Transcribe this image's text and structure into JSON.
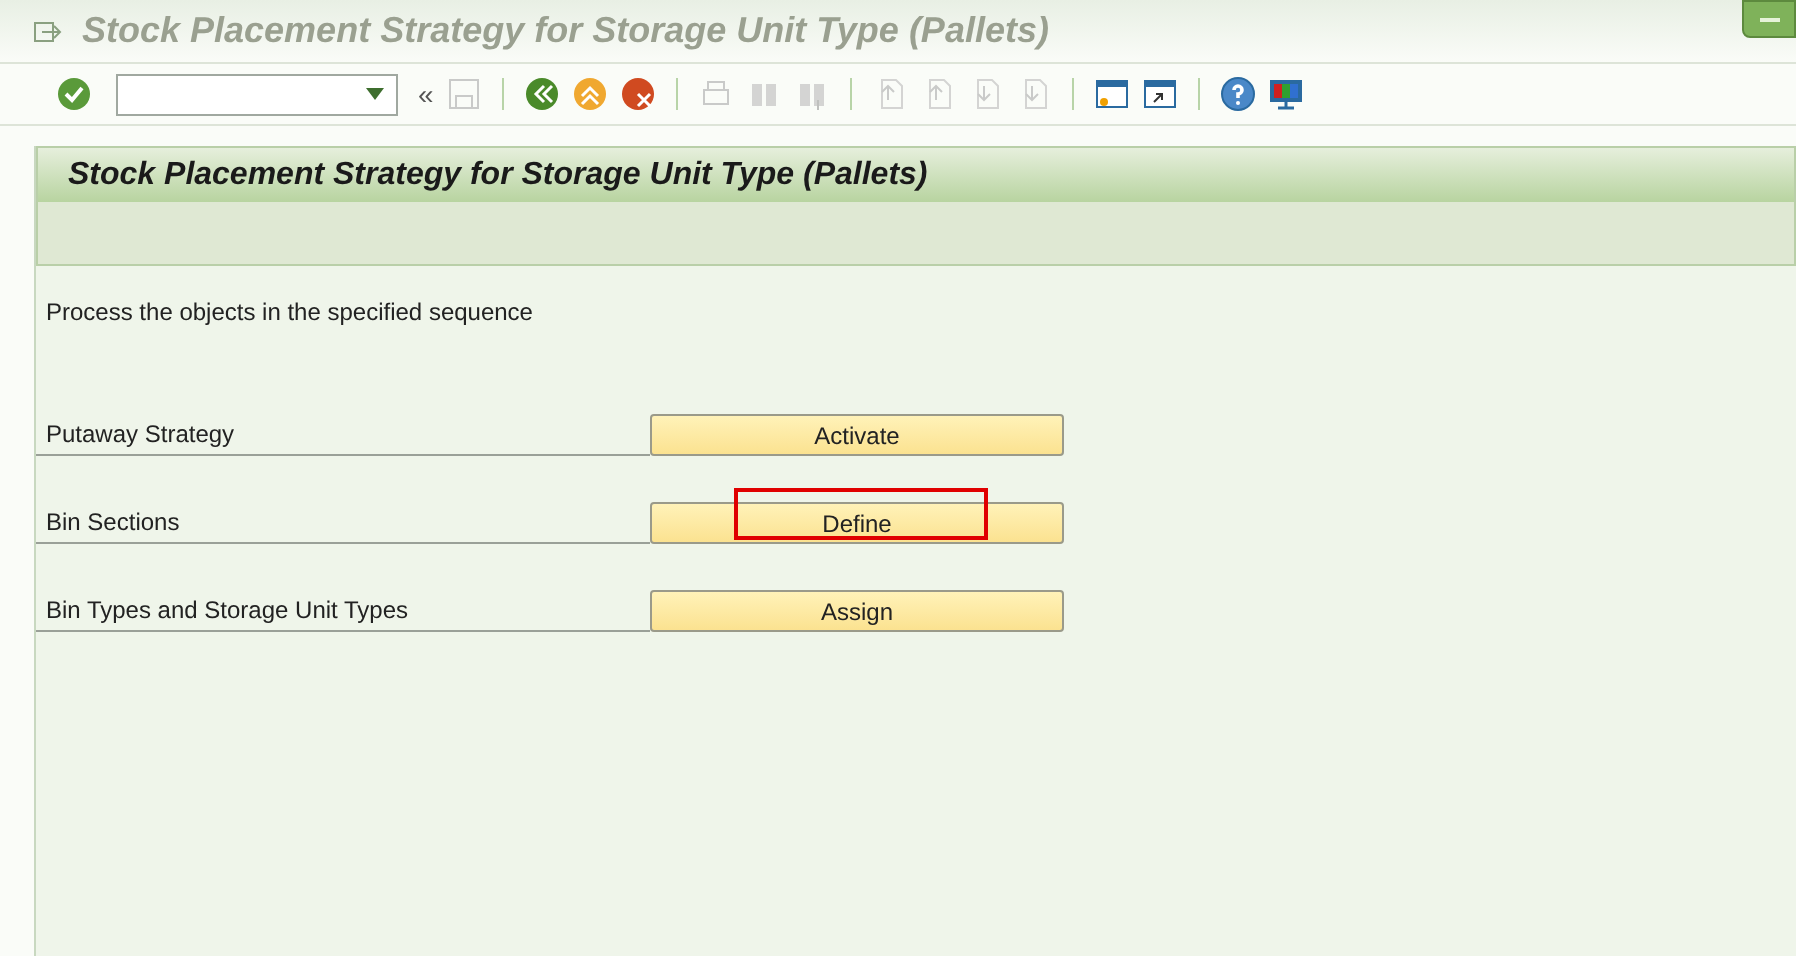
{
  "window": {
    "title": "Stock Placement Strategy for Storage Unit Type (Pallets)"
  },
  "toolbar": {
    "collapse_glyph": "«"
  },
  "panel": {
    "title": "Stock Placement Strategy for Storage Unit Type (Pallets)",
    "instruction": "Process the objects in the specified sequence",
    "steps": [
      {
        "label": "Putaway Strategy",
        "action": "Activate",
        "highlighted": false
      },
      {
        "label": "Bin Sections",
        "action": "Define",
        "highlighted": true
      },
      {
        "label": "Bin Types and Storage Unit Types",
        "action": "Assign",
        "highlighted": false
      }
    ]
  }
}
